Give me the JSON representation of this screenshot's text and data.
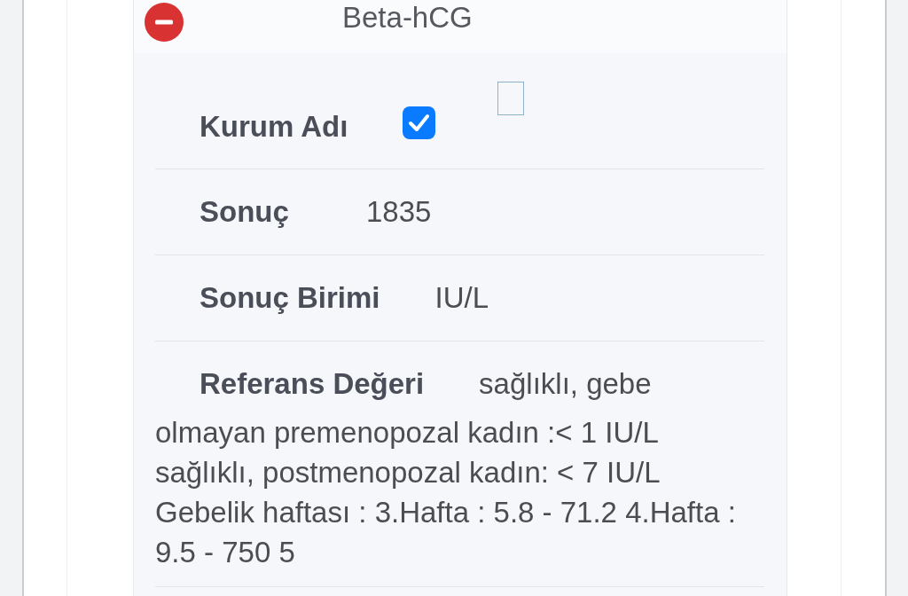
{
  "section": {
    "title": "Beta-hCG",
    "expanded": true
  },
  "fields": [
    {
      "kind": "checkbox",
      "label": "Kurum Adı",
      "checked": true
    },
    {
      "kind": "text",
      "label": "Sonuç",
      "value": "1835"
    },
    {
      "kind": "text",
      "label": "Sonuç Birimi",
      "value": "IU/L"
    },
    {
      "kind": "text",
      "label": "Referans Değeri",
      "value": "sağlıklı, gebe olmayan premenopozal kadın :< 1 IU/L sağlıklı, postmenopozal kadın: < 7 IU/L Gebelik haftası : 3.Hafta : 5.8 - 71.2 4.Hafta : 9.5 - 750 5"
    }
  ]
}
